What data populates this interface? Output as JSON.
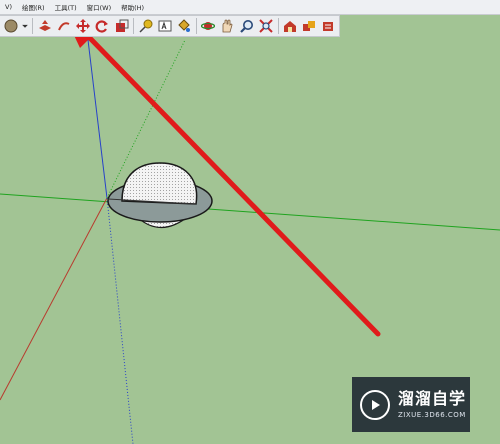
{
  "menu": {
    "items": [
      "V)",
      "绘图(R)",
      "工具(T)",
      "窗口(W)",
      "帮助(H)"
    ]
  },
  "toolbar": {
    "buttons": [
      {
        "name": "style-swatch-icon"
      },
      {
        "name": "dropdown-arrow-icon"
      },
      {
        "name": "push-pull-icon"
      },
      {
        "name": "follow-me-icon"
      },
      {
        "name": "move-icon"
      },
      {
        "name": "rotate-icon"
      },
      {
        "name": "scale-icon"
      },
      {
        "name": "tape-measure-icon"
      },
      {
        "name": "text-label-icon"
      },
      {
        "name": "paint-bucket-icon"
      },
      {
        "name": "orbit-icon"
      },
      {
        "name": "pan-icon"
      },
      {
        "name": "zoom-icon"
      },
      {
        "name": "zoom-extents-icon"
      },
      {
        "name": "warehouse-icon"
      },
      {
        "name": "components-icon"
      },
      {
        "name": "extension-icon"
      }
    ]
  },
  "colors": {
    "canvas_background": "#a2c494",
    "axis_red": "#b83b2e",
    "axis_green": "#1fa31f",
    "axis_blue": "#2741c9",
    "arrow": "#e01b1b",
    "saturn_ring": "#8c9a99"
  },
  "watermark": {
    "title": "溜溜自学",
    "url": "ZIXUE.3D66.COM",
    "logo_icon": "play-triangle-icon"
  }
}
